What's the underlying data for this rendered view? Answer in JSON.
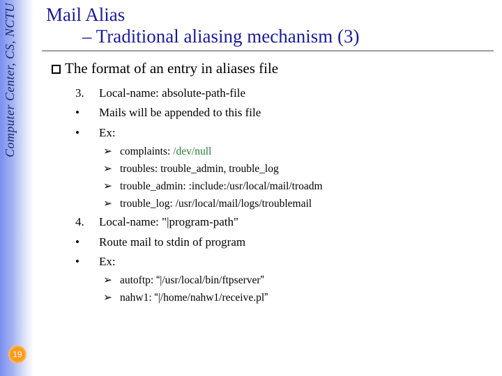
{
  "sidebar": {
    "label": "Computer Center, CS, NCTU"
  },
  "page_number": "19",
  "title": {
    "line1": "Mail Alias",
    "line2_prefix": "– ",
    "line2": "Traditional aliasing mechanism (3)"
  },
  "heading": "The format of an entry in aliases file",
  "sections": [
    {
      "num": "3.",
      "head": "Local-name: absolute-path-file",
      "bullets": [
        {
          "text": "Mails will be appended to this file"
        },
        {
          "text": "Ex:",
          "items": [
            {
              "prefix": "complaints: ",
              "value": "/dev/null",
              "value_class": "devnull"
            },
            {
              "text": "troubles: trouble_admin, trouble_log"
            },
            {
              "text": "trouble_admin: :include:/usr/local/mail/troadm"
            },
            {
              "text": "trouble_log: /usr/local/mail/logs/troublemail"
            }
          ]
        }
      ]
    },
    {
      "num": "4.",
      "head": "Local-name: \"|program-path\"",
      "bullets": [
        {
          "text": "Route mail to stdin of program"
        },
        {
          "text": "Ex:",
          "items": [
            {
              "qprefix": "autoftp: ",
              "qvalue": "|/usr/local/bin/ftpserver"
            },
            {
              "qprefix": "nahw1: ",
              "qvalue": "|/home/nahw1/receive.pl"
            }
          ]
        }
      ]
    }
  ],
  "glyphs": {
    "arrow": "➢",
    "bullet": "•",
    "lq": "“",
    "rq": "”"
  }
}
